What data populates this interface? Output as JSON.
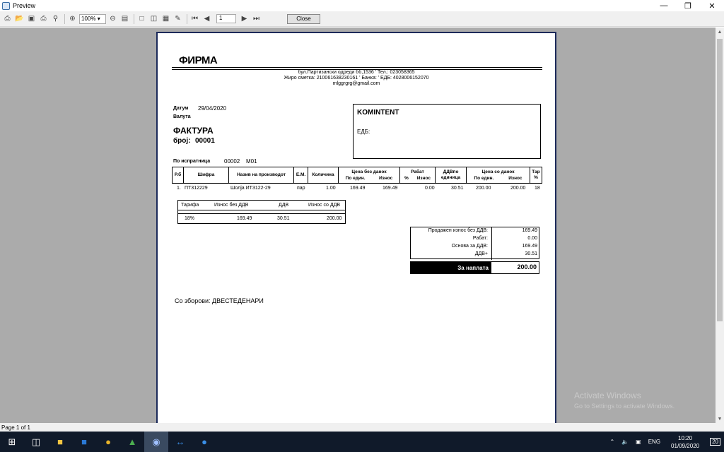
{
  "window": {
    "title": "Preview"
  },
  "toolbar": {
    "zoom": "100%",
    "page": "1",
    "close_label": "Close"
  },
  "invoice": {
    "firm": "ФИРМА",
    "address": "бул.Партизански одреди бб,1536 ' Тел.: 023058365",
    "account": "Жиро сметка: 210061638230161 ' Банка:   ' ЕДБ: 4028006152070",
    "email": "mlggrgrg@gmail.com",
    "date_label": "Датум",
    "date_value": "29/04/2020",
    "currency_label": "Валута",
    "doc_title": "ФАКТУРА",
    "doc_no_label": "број:",
    "doc_no": "00001",
    "kominent_title": "KOMINTENT",
    "edb_label": "ЕДБ:",
    "delivery_label": "По испратница",
    "delivery_no": "00002",
    "delivery_code": "М01",
    "table_headers": {
      "rb": "Р.б",
      "code": "Шифра",
      "name": "Назив на производот",
      "em": "Е.М.",
      "qty": "Количина",
      "price_no_tax": "Цена без данок",
      "per_unit": "По един.",
      "amount": "Износ",
      "discount": "Рабат",
      "pct": "%",
      "disc_amount": "Износ",
      "vat_per_unit": "ДДВпо единица",
      "price_with_tax": "Цена со данок",
      "per_unit2": "По един.",
      "amount2": "Износ",
      "tar": "Тар %"
    },
    "row": {
      "rb": "1.",
      "code": "ПТ312229",
      "name": "Шолја ИТ3122-29",
      "em": "пар",
      "qty": "1.00",
      "unit_price": "169.49",
      "amount": "169.49",
      "discount": "0.00",
      "vat": "30.51",
      "unit_price_tax": "200.00",
      "amount_tax": "200.00",
      "tar": "18"
    },
    "tax": {
      "h_tariff": "Тарифа",
      "h_no_vat": "Износ без ДДВ",
      "h_vat": "ДДВ",
      "h_with_vat": "Износ со ДДВ",
      "rate": "18%",
      "no_vat": "169.49",
      "vat": "30.51",
      "with_vat": "200.00"
    },
    "totals": {
      "sold_label": "Продажен износ без ДДВ:",
      "sold": "169.49",
      "disc_label": "Рабат:",
      "disc": "0.00",
      "base_label": "Основа за ДДВ:",
      "base": "169.49",
      "vat_label": "ДДВ+",
      "vat": "30.51",
      "pay_label": "За наплата",
      "pay": "200.00"
    },
    "words_label": "Со зборови: ДВЕСТЕДЕНАРИ"
  },
  "status": {
    "page_of": "Page 1 of 1"
  },
  "watermark": {
    "line1": "Activate Windows",
    "line2": "Go to Settings to activate Windows."
  },
  "tray": {
    "lang": "ENG",
    "time": "10:20",
    "date": "01/09/2020",
    "notif": "20"
  }
}
